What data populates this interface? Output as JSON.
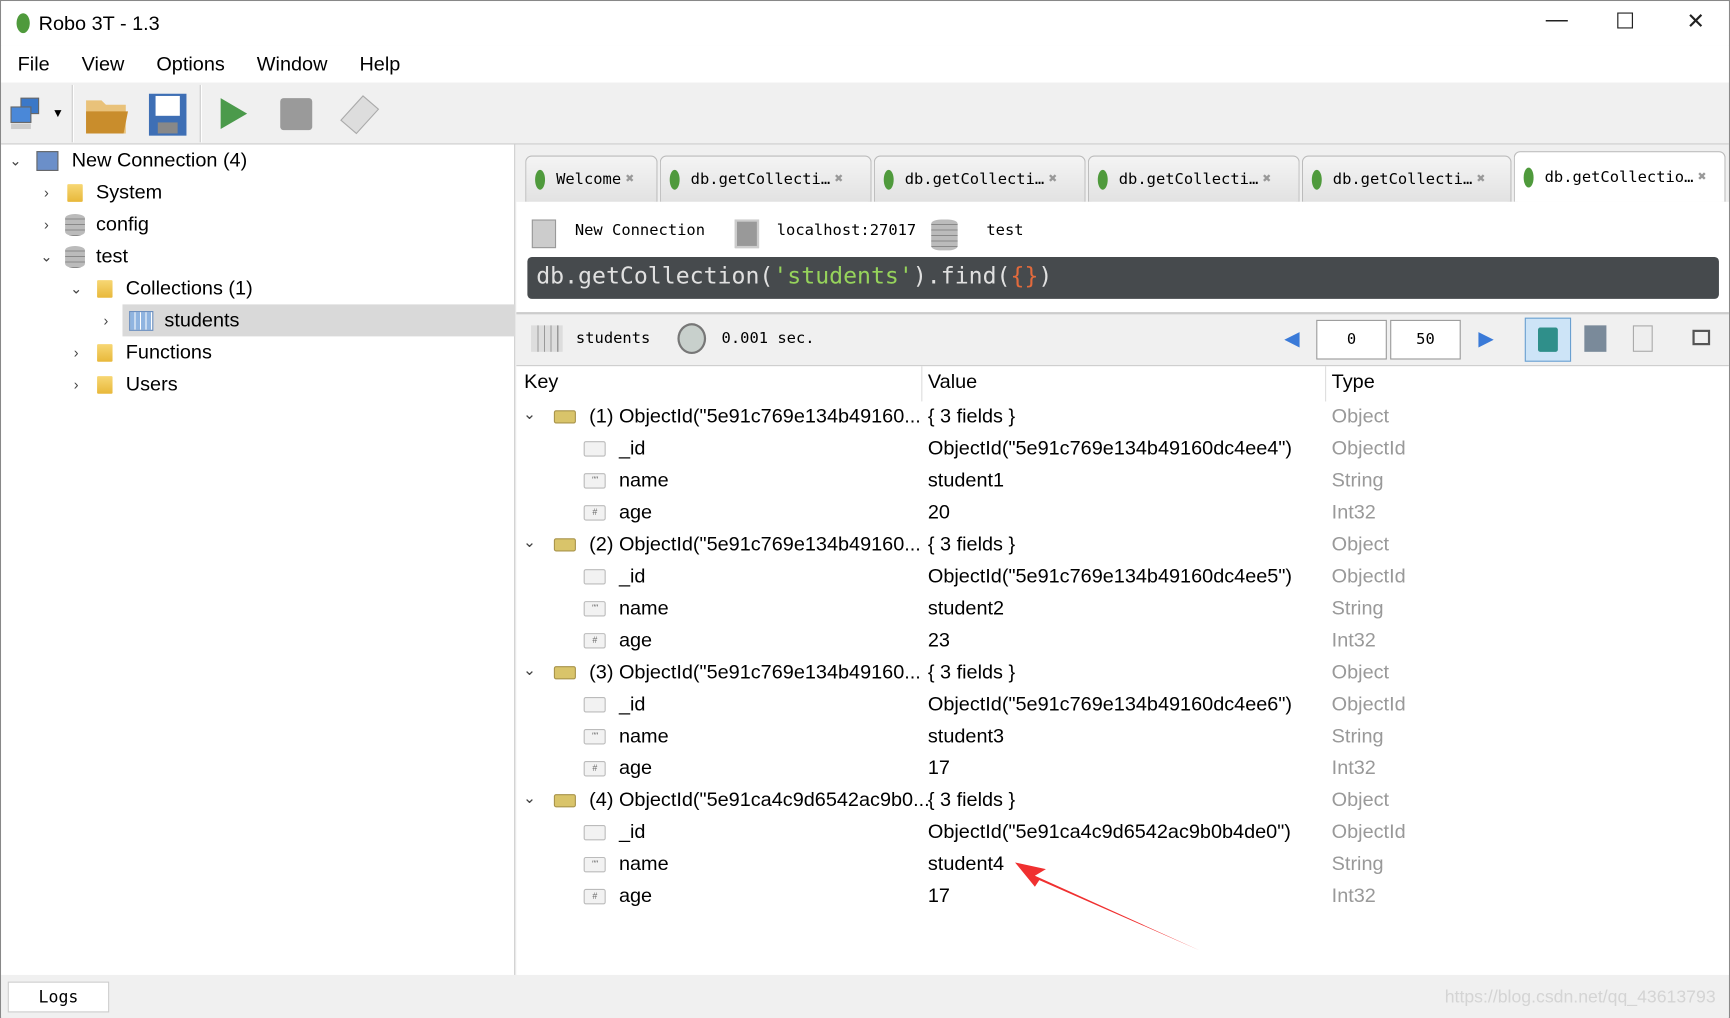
{
  "window": {
    "title": "Robo 3T - 1.3",
    "minimize": "—",
    "maximize": "☐",
    "close": "✕"
  },
  "menu": [
    "File",
    "View",
    "Options",
    "Window",
    "Help"
  ],
  "toolbar": {
    "icons": [
      "connect-icon",
      "open-icon",
      "save-icon",
      "execute-icon",
      "stop-icon",
      "rotate-icon"
    ]
  },
  "tree": {
    "connection": "New Connection (4)",
    "system": "System",
    "config": "config",
    "test": "test",
    "collections": "Collections (1)",
    "students": "students",
    "functions": "Functions",
    "users": "Users"
  },
  "tabs": [
    "Welcome",
    "db.getCollecti…",
    "db.getCollecti…",
    "db.getCollecti…",
    "db.getCollecti…",
    "db.getCollectio…"
  ],
  "info": {
    "connection": "New Connection",
    "host": "localhost:27017",
    "db": "test"
  },
  "query": {
    "p1": "db.getCollection(",
    "p2": "'students'",
    "p3": ").find(",
    "p4": "{}",
    "p5": ")"
  },
  "results": {
    "collection": "students",
    "time": "0.001 sec.",
    "skip": "0",
    "limit": "50"
  },
  "columns": {
    "key": "Key",
    "value": "Value",
    "type": "Type"
  },
  "documents": [
    {
      "key": "(1) ObjectId(\"5e91c769e134b49160...",
      "value": "{ 3 fields }",
      "type": "Object",
      "fields": [
        {
          "key": "_id",
          "value": "ObjectId(\"5e91c769e134b49160dc4ee4\")",
          "type": "ObjectId"
        },
        {
          "key": "name",
          "value": "student1",
          "type": "String"
        },
        {
          "key": "age",
          "value": "20",
          "type": "Int32"
        }
      ]
    },
    {
      "key": "(2) ObjectId(\"5e91c769e134b49160...",
      "value": "{ 3 fields }",
      "type": "Object",
      "fields": [
        {
          "key": "_id",
          "value": "ObjectId(\"5e91c769e134b49160dc4ee5\")",
          "type": "ObjectId"
        },
        {
          "key": "name",
          "value": "student2",
          "type": "String"
        },
        {
          "key": "age",
          "value": "23",
          "type": "Int32"
        }
      ]
    },
    {
      "key": "(3) ObjectId(\"5e91c769e134b49160...",
      "value": "{ 3 fields }",
      "type": "Object",
      "fields": [
        {
          "key": "_id",
          "value": "ObjectId(\"5e91c769e134b49160dc4ee6\")",
          "type": "ObjectId"
        },
        {
          "key": "name",
          "value": "student3",
          "type": "String"
        },
        {
          "key": "age",
          "value": "17",
          "type": "Int32"
        }
      ]
    },
    {
      "key": "(4) ObjectId(\"5e91ca4c9d6542ac9b0...",
      "value": "{ 3 fields }",
      "type": "Object",
      "fields": [
        {
          "key": "_id",
          "value": "ObjectId(\"5e91ca4c9d6542ac9b0b4de0\")",
          "type": "ObjectId"
        },
        {
          "key": "name",
          "value": "student4",
          "type": "String"
        },
        {
          "key": "age",
          "value": "17",
          "type": "Int32"
        }
      ]
    }
  ],
  "status": {
    "logs": "Logs",
    "watermark": "https://blog.csdn.net/qq_43613793"
  },
  "colors": {
    "accent": "#4f9a3c",
    "query_bg": "#464a4d",
    "annotation_arrow": "#f03030"
  }
}
